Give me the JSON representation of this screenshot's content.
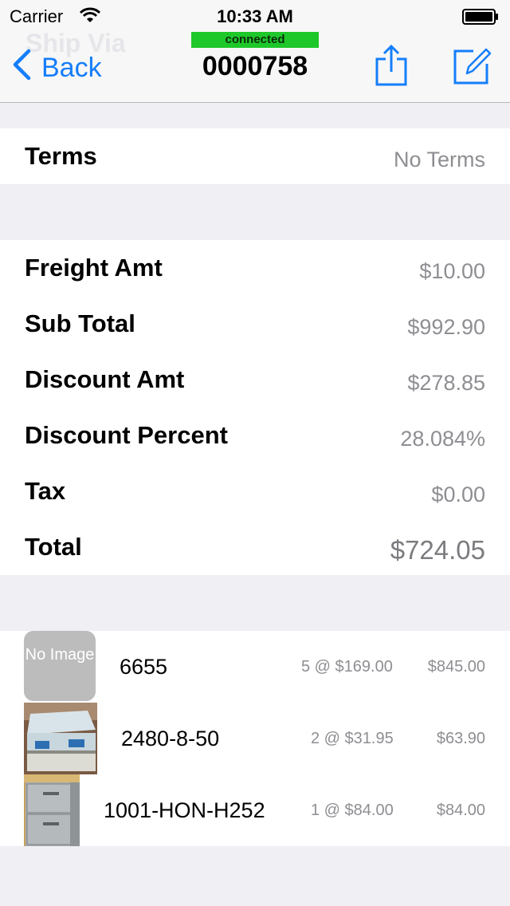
{
  "status": {
    "carrier": "Carrier",
    "time": "10:33 AM"
  },
  "nav": {
    "ghost_title": "Ship Via",
    "connection_badge": "connected",
    "title": "0000758",
    "back_label": "Back",
    "share_icon": "share-icon",
    "compose_icon": "compose-icon"
  },
  "terms": {
    "label": "Terms",
    "value": "No Terms"
  },
  "totals": [
    {
      "label": "Freight Amt",
      "value": "$10.00"
    },
    {
      "label": "Sub Total",
      "value": "$992.90"
    },
    {
      "label": "Discount Amt",
      "value": "$278.85"
    },
    {
      "label": "Discount Percent",
      "value": "28.084%"
    },
    {
      "label": "Tax",
      "value": "$0.00"
    },
    {
      "label": "Total",
      "value": "$724.05"
    }
  ],
  "line_items": [
    {
      "image": "No Image",
      "sku": "6655",
      "qty_price": "5 @ $169.00",
      "extended": "$845.00"
    },
    {
      "image": "display-case-photo",
      "sku": "2480-8-50",
      "qty_price": "2 @ $31.95",
      "extended": "$63.90"
    },
    {
      "image": "file-cabinet-photo",
      "sku": "1001-HON-H252",
      "qty_price": "1 @ $84.00",
      "extended": "$84.00"
    }
  ],
  "colors": {
    "accent": "#157efb",
    "connected": "#1ec72a",
    "secondary_text": "#8e8e93",
    "background": "#efeff4"
  }
}
